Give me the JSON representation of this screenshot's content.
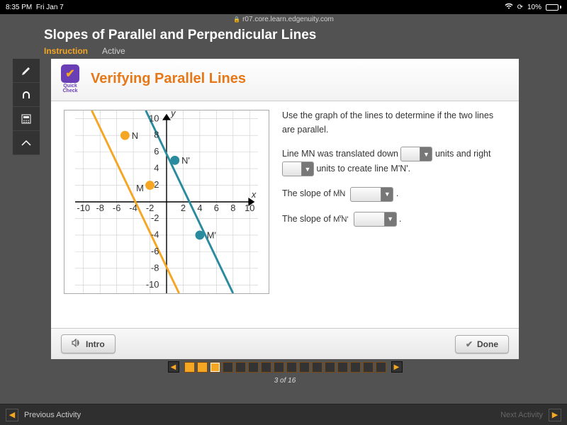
{
  "status": {
    "time": "8:35 PM",
    "date": "Fri Jan 7",
    "battery_pct": "10%"
  },
  "url": "r07.core.learn.edgenuity.com",
  "header": {
    "title": "Slopes of Parallel and Perpendicular Lines",
    "tab_instruction": "Instruction",
    "tab_active": "Active"
  },
  "quick_check": {
    "line1": "Quick",
    "line2": "Check"
  },
  "lesson_title": "Verifying Parallel Lines",
  "question": {
    "intro": "Use the graph of the lines to determine if the two lines are parallel.",
    "p1a": "Line MN was translated down ",
    "p1b": " units and right ",
    "p1c": " units to create line M'N'.",
    "p2a": "The slope of ",
    "p2a_vec": "MN",
    "p2c": ".",
    "p3a": "The slope of ",
    "p3a_vec": "M'N'",
    "p3c": "."
  },
  "footer": {
    "intro": "Intro",
    "done": "Done"
  },
  "progress": {
    "text": "3 of 16"
  },
  "bottom": {
    "prev": "Previous Activity",
    "next": "Next Activity"
  },
  "chart_data": {
    "type": "line",
    "title": "",
    "xlabel": "x",
    "ylabel": "y",
    "xlim": [
      -11,
      11
    ],
    "ylim": [
      -11,
      11
    ],
    "x_ticks": [
      -10,
      -8,
      -6,
      -4,
      -2,
      2,
      4,
      6,
      8,
      10
    ],
    "y_ticks": [
      -10,
      -8,
      -6,
      -4,
      -2,
      2,
      4,
      6,
      8,
      10
    ],
    "series": [
      {
        "name": "MN",
        "color": "#f5a623",
        "points_labeled": {
          "N": [
            -5,
            8
          ],
          "M": [
            -2,
            2
          ]
        },
        "line_through": [
          [
            -5,
            8
          ],
          [
            -2,
            2
          ]
        ]
      },
      {
        "name": "M'N'",
        "color": "#2a8b9e",
        "points_labeled": {
          "N'": [
            1,
            5
          ],
          "M'": [
            4,
            -4
          ]
        },
        "line_through": [
          [
            1,
            5
          ],
          [
            4,
            -4
          ]
        ]
      }
    ]
  }
}
